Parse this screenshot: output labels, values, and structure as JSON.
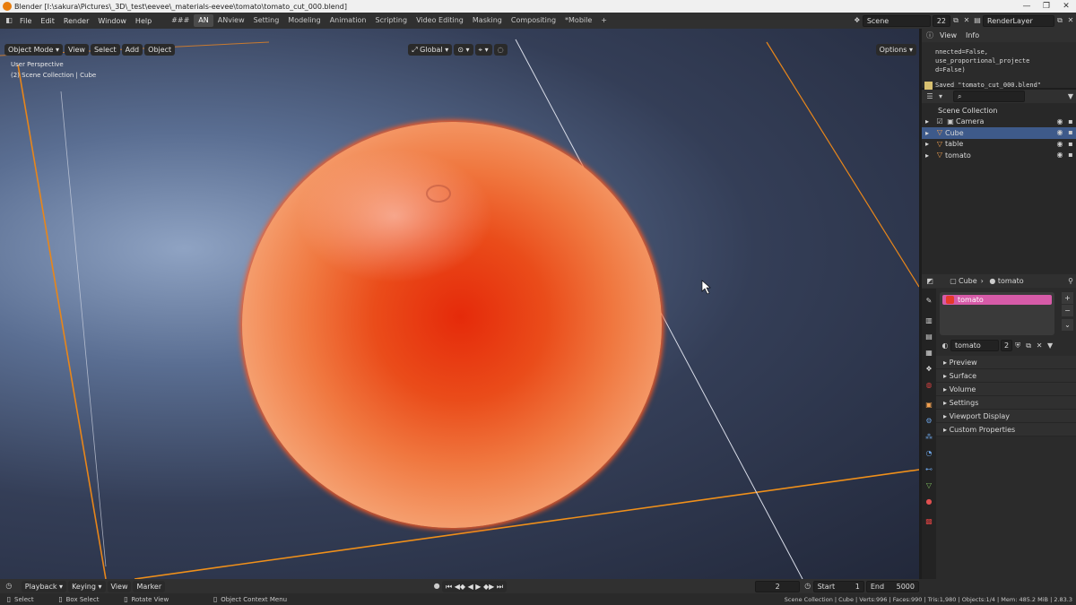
{
  "window": {
    "title": "Blender [I:\\sakura\\Pictures\\_3D\\_test\\eevee\\_materials-eevee\\tomato\\tomato_cut_000.blend]",
    "controls": [
      "—",
      "❐",
      "✕"
    ]
  },
  "menu": [
    "File",
    "Edit",
    "Render",
    "Window",
    "Help"
  ],
  "workspaces": {
    "tabs": [
      "###",
      "AN",
      "ANview",
      "Setting",
      "Modeling",
      "Animation",
      "Scripting",
      "Video Editing",
      "Masking",
      "Compositing",
      "*Mobile"
    ],
    "active": "AN",
    "add": "+"
  },
  "scene": {
    "name": "Scene",
    "number": "22",
    "render_layer": "RenderLayer"
  },
  "viewport_header": {
    "mode": "Object Mode",
    "menus": [
      "View",
      "Select",
      "Add",
      "Object"
    ],
    "orientation": "Global",
    "options": "Options"
  },
  "viewport_overlay": {
    "perspective": "User Perspective",
    "collection": "(2) Scene Collection | Cube"
  },
  "info_editor": {
    "menus": [
      "View",
      "Info"
    ],
    "log_lines": [
      "nnected=False, use_proportional_projecte",
      "d=False)"
    ],
    "saved": "Saved \"tomato_cut_000.blend\""
  },
  "outliner": {
    "root": "Scene Collection",
    "items": [
      {
        "name": "Camera",
        "selected": false
      },
      {
        "name": "Cube",
        "selected": true
      },
      {
        "name": "table",
        "selected": false
      },
      {
        "name": "tomato",
        "selected": false
      }
    ]
  },
  "properties": {
    "breadcrumb_object": "Cube",
    "breadcrumb_material": "tomato",
    "slot_name": "tomato",
    "slot_color": "#e63a2a",
    "material_name": "tomato",
    "material_users": "2",
    "sections": [
      "Preview",
      "Surface",
      "Volume",
      "Settings",
      "Viewport Display",
      "Custom Properties"
    ]
  },
  "timeline": {
    "menus": [
      "Playback",
      "Keying",
      "View",
      "Marker"
    ],
    "current_frame": "2",
    "start_label": "Start",
    "start": "1",
    "end_label": "End",
    "end": "5000"
  },
  "statusbar": {
    "select": "Select",
    "box_select": "Box Select",
    "rotate_view": "Rotate View",
    "context_menu": "Object Context Menu",
    "stats": "Scene Collection | Cube | Verts:996 | Faces:990 | Tris:1,980 | Objects:1/4 | Mem: 485.2 MiB | 2.83.3"
  },
  "colors": {
    "accent": "#e87d0d",
    "selection": "#3e5a8a",
    "material_slot": "#d65ba8"
  }
}
